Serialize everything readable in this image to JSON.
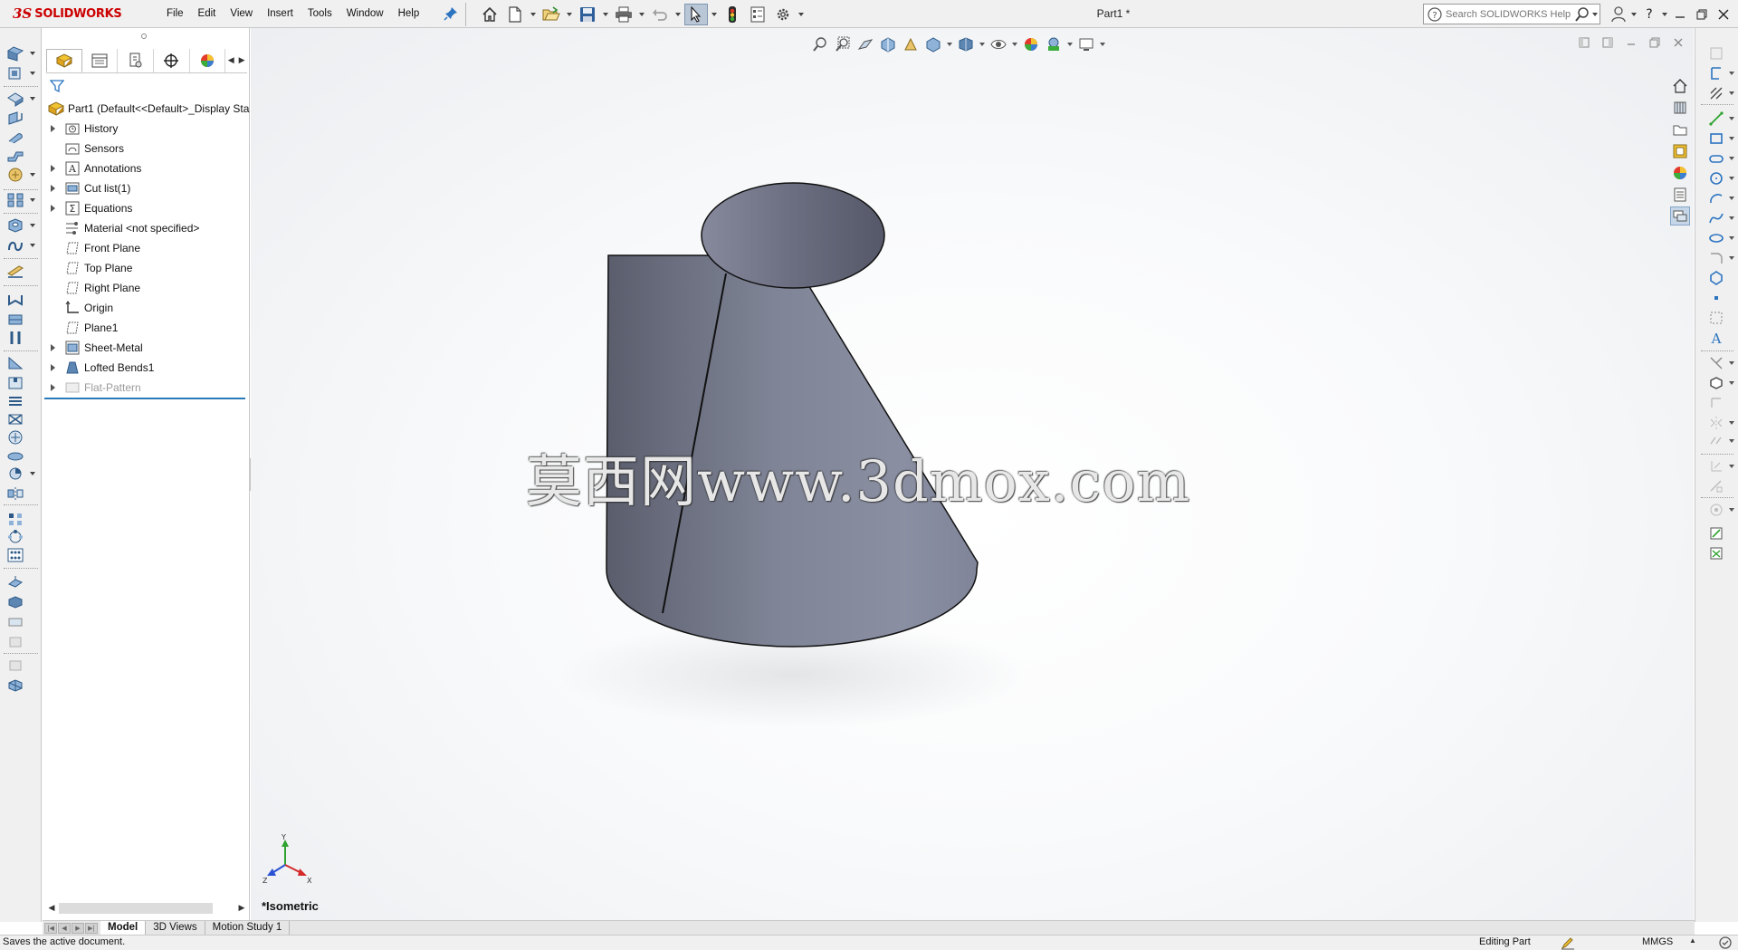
{
  "app": {
    "logo_ds": "3S",
    "logo_text": "SOLIDWORKS",
    "document_title": "Part1 *"
  },
  "menu": [
    "File",
    "Edit",
    "View",
    "Insert",
    "Tools",
    "Window",
    "Help"
  ],
  "search": {
    "placeholder": "Search SOLIDWORKS Help"
  },
  "quick_access_icons": [
    "home-icon",
    "new-document-icon",
    "open-icon",
    "save-icon",
    "print-icon",
    "undo-icon",
    "select-icon",
    "rebuild-icon",
    "file-properties-icon",
    "options-icon"
  ],
  "feature_tree": {
    "root": "Part1  (Default<<Default>_Display Sta",
    "items": [
      {
        "label": "History",
        "icon": "history-folder-icon",
        "expandable": true
      },
      {
        "label": "Sensors",
        "icon": "sensors-folder-icon",
        "expandable": false
      },
      {
        "label": "Annotations",
        "icon": "annotations-icon",
        "expandable": true
      },
      {
        "label": "Cut list(1)",
        "icon": "cut-list-icon",
        "expandable": true
      },
      {
        "label": "Equations",
        "icon": "equations-icon",
        "expandable": true
      },
      {
        "label": "Material <not specified>",
        "icon": "material-icon",
        "expandable": false
      },
      {
        "label": "Front Plane",
        "icon": "plane-icon",
        "expandable": false
      },
      {
        "label": "Top Plane",
        "icon": "plane-icon",
        "expandable": false
      },
      {
        "label": "Right Plane",
        "icon": "plane-icon",
        "expandable": false
      },
      {
        "label": "Origin",
        "icon": "origin-icon",
        "expandable": false
      },
      {
        "label": "Plane1",
        "icon": "plane-icon",
        "expandable": false
      },
      {
        "label": "Sheet-Metal",
        "icon": "sheet-metal-icon",
        "expandable": true
      },
      {
        "label": "Lofted Bends1",
        "icon": "lofted-bends-icon",
        "expandable": true
      },
      {
        "label": "Flat-Pattern",
        "icon": "flat-pattern-icon",
        "expandable": true,
        "suppressed": true
      }
    ]
  },
  "viewport": {
    "watermark": "莫西网www.3dmox.com",
    "view_orientation": "*Isometric",
    "triad_labels": {
      "x": "X",
      "y": "Y",
      "z": "Z"
    }
  },
  "bottom_tabs": [
    {
      "label": "Model",
      "active": true
    },
    {
      "label": "3D Views",
      "active": false
    },
    {
      "label": "Motion Study 1",
      "active": false
    }
  ],
  "status": {
    "message": "Saves the active document.",
    "mode": "Editing Part",
    "units": "MMGS",
    "units_caret": "▲"
  },
  "colors": {
    "brand": "#cc0000",
    "part_face": "#7f8496",
    "rollback_bar": "#2a7ab8",
    "selected_tool": "#b9c6d6"
  }
}
